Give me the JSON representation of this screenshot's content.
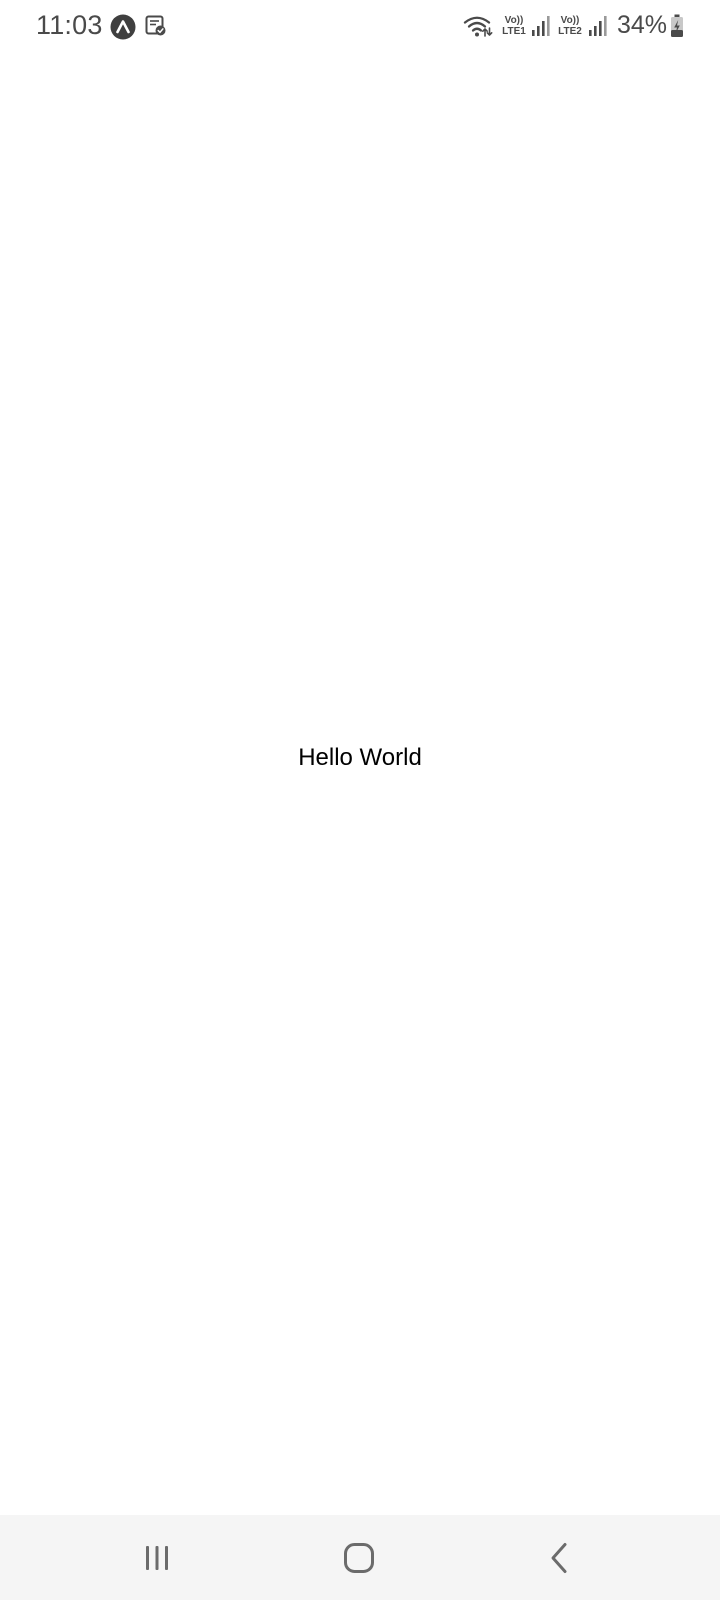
{
  "status_bar": {
    "time": "11:03",
    "volte1_top": "Vo))",
    "volte1_bottom": "LTE1",
    "volte2_top": "Vo))",
    "volte2_bottom": "LTE2",
    "battery": "34%",
    "icons": [
      "app-notification-icon",
      "task-notification-icon",
      "wifi-icon",
      "signal-icon",
      "signal-icon",
      "battery-charging-icon"
    ]
  },
  "main": {
    "text": "Hello World"
  },
  "nav_bar": {
    "buttons": [
      "recents-icon",
      "home-icon",
      "back-icon"
    ]
  },
  "colors": {
    "status_text": "#4a4a4a",
    "background": "#ffffff",
    "nav_background": "#f5f5f5",
    "nav_icon": "#6b6b6b"
  }
}
